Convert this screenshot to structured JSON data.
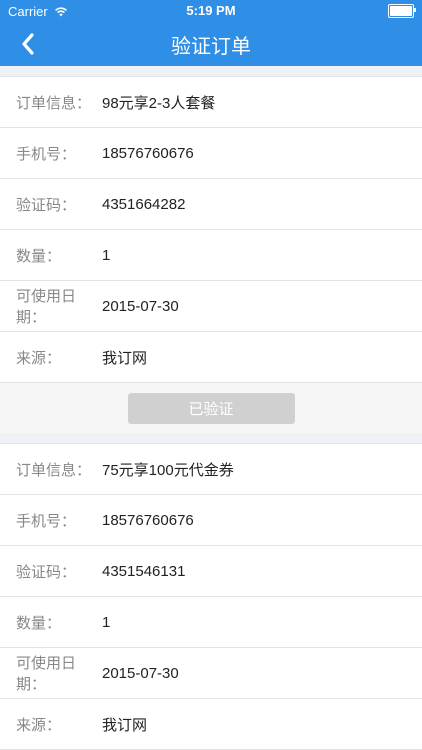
{
  "status_bar": {
    "carrier": "Carrier",
    "time": "5:19 PM"
  },
  "nav": {
    "title": "验证订单"
  },
  "labels": {
    "order_info": "订单信息：",
    "phone": "手机号：",
    "code": "验证码：",
    "qty": "数量：",
    "date": "可使用日期：",
    "source": "来源："
  },
  "orders": [
    {
      "order_info": "98元享2-3人套餐",
      "phone": "18576760676",
      "code": "4351664282",
      "qty": "1",
      "date": "2015-07-30",
      "source": "我订网",
      "button": "已验证"
    },
    {
      "order_info": "75元享100元代金券",
      "phone": "18576760676",
      "code": "4351546131",
      "qty": "1",
      "date": "2015-07-30",
      "source": "我订网"
    }
  ]
}
